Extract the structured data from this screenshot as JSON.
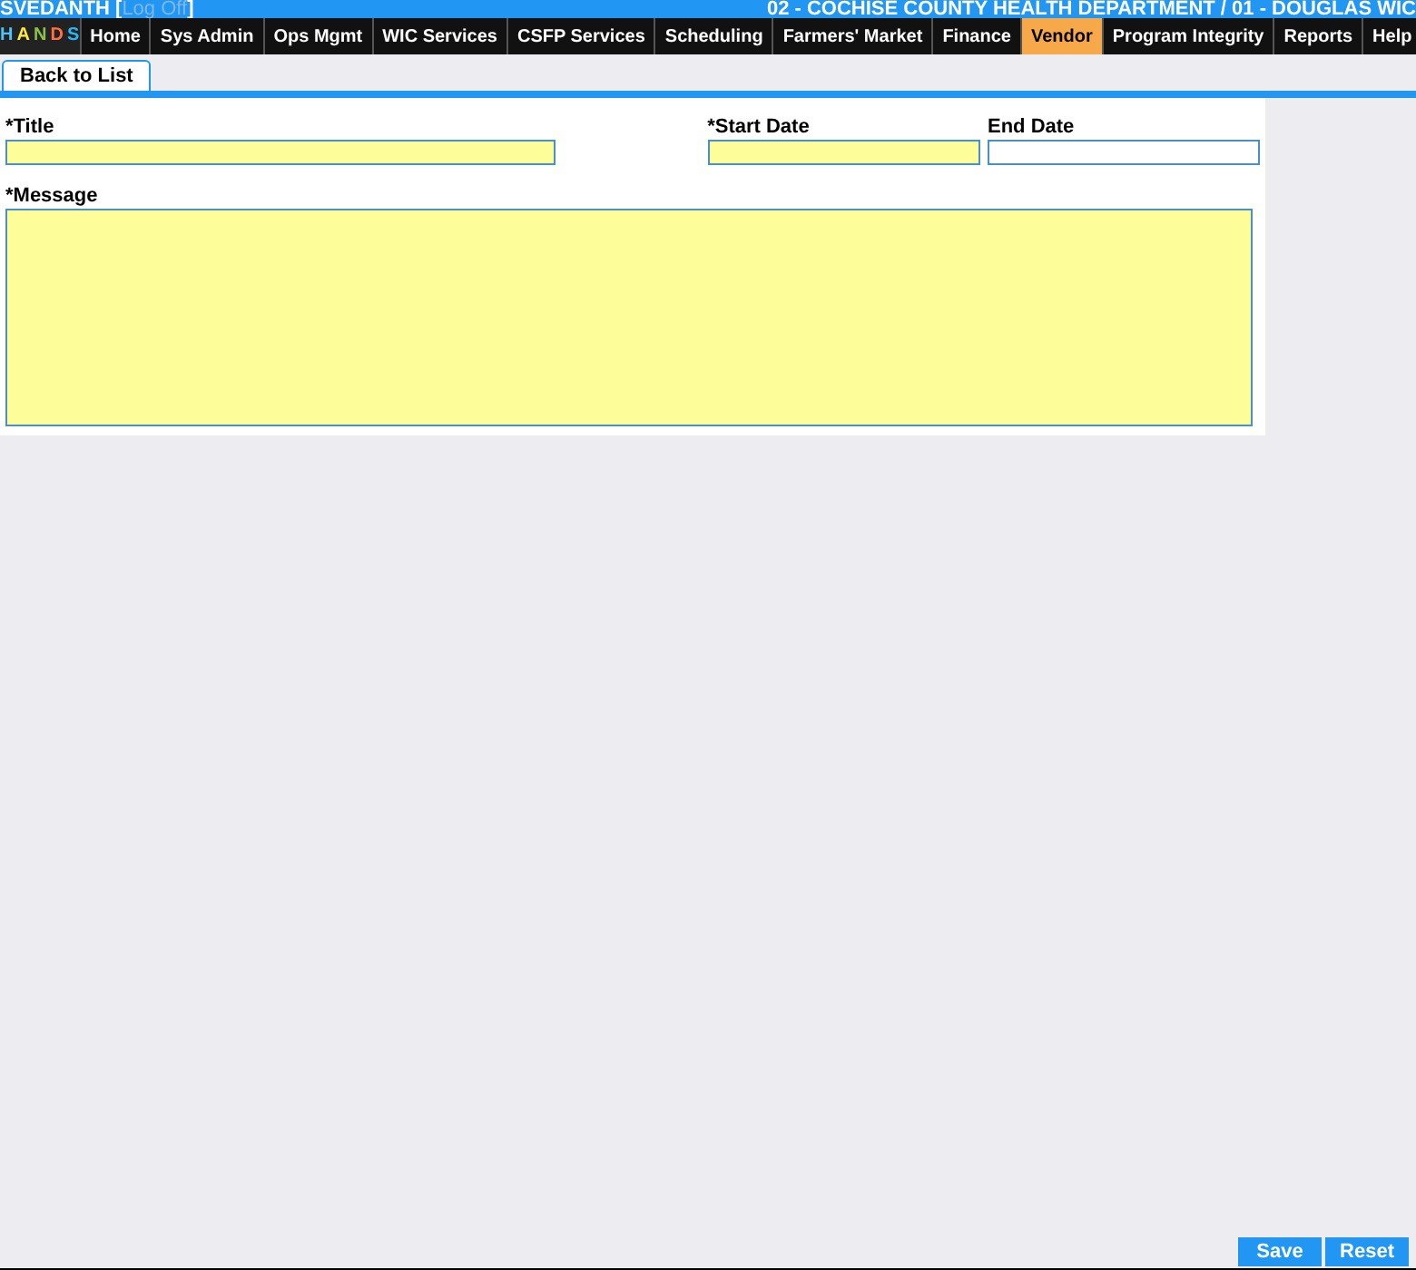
{
  "header": {
    "user": "SVEDANTH",
    "bracket_open": "[",
    "logoff": "Log Off",
    "bracket_close": "]",
    "agency": "02 - COCHISE COUNTY HEALTH DEPARTMENT / 01 - DOUGLAS WIC"
  },
  "logo": {
    "letters": [
      "H",
      "A",
      "N",
      "D",
      "S"
    ]
  },
  "nav": [
    {
      "label": "Home",
      "selected": false
    },
    {
      "label": "Sys Admin",
      "selected": false
    },
    {
      "label": "Ops Mgmt",
      "selected": false
    },
    {
      "label": "WIC Services",
      "selected": false
    },
    {
      "label": "CSFP Services",
      "selected": false
    },
    {
      "label": "Scheduling",
      "selected": false
    },
    {
      "label": "Farmers' Market",
      "selected": false
    },
    {
      "label": "Finance",
      "selected": false
    },
    {
      "label": "Vendor",
      "selected": true
    },
    {
      "label": "Program Integrity",
      "selected": false
    },
    {
      "label": "Reports",
      "selected": false
    },
    {
      "label": "Help",
      "selected": false
    }
  ],
  "back_tab": "Back to List",
  "form": {
    "title": {
      "label": "*Title",
      "required": true
    },
    "start_date": {
      "label": "*Start Date",
      "required": true
    },
    "end_date": {
      "label": "End Date",
      "required": false
    },
    "message": {
      "label": "*Message",
      "required": true
    }
  },
  "buttons": [
    "Save",
    "Reset"
  ]
}
